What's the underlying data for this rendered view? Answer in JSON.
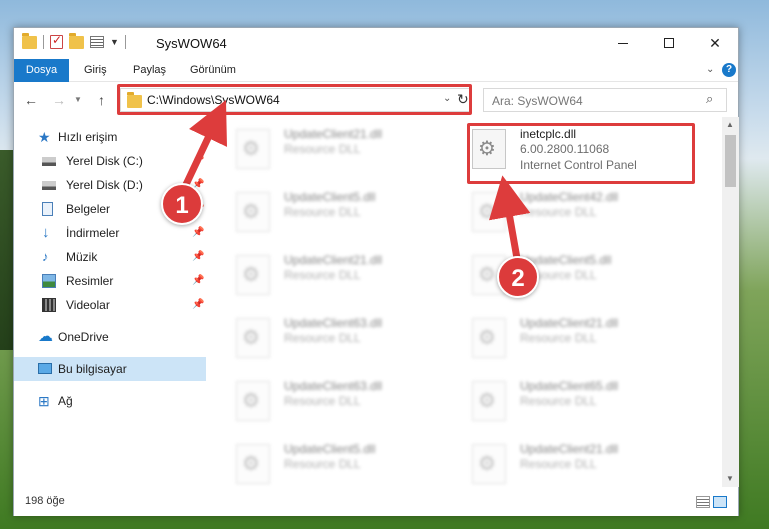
{
  "window": {
    "title": "SysWOW64",
    "min_glyph": "",
    "close_glyph": "✕"
  },
  "ribbon": {
    "tabs": [
      "Dosya",
      "Giriş",
      "Paylaş",
      "Görünüm"
    ],
    "help": "?"
  },
  "address": {
    "path": "C:\\Windows\\SysWOW64",
    "search_placeholder": "Ara: SysWOW64"
  },
  "nav": {
    "back": "←",
    "forward": "→",
    "up": "↑",
    "items": [
      {
        "label": "Hızlı erişim",
        "icon": "star-icon"
      },
      {
        "label": "Yerel Disk (C:)",
        "icon": "drive-icon"
      },
      {
        "label": "Yerel Disk (D:)",
        "icon": "drive-icon"
      },
      {
        "label": "Belgeler",
        "icon": "documents-icon"
      },
      {
        "label": "İndirmeler",
        "icon": "download-icon"
      },
      {
        "label": "Müzik",
        "icon": "music-icon"
      },
      {
        "label": "Resimler",
        "icon": "pictures-icon"
      },
      {
        "label": "Videolar",
        "icon": "videos-icon"
      },
      {
        "label": "OneDrive",
        "icon": "cloud-icon"
      },
      {
        "label": "Bu bilgisayar",
        "icon": "computer-icon"
      },
      {
        "label": "Ağ",
        "icon": "network-icon"
      }
    ]
  },
  "files": [
    {
      "name": "UpdateClient21.dll",
      "type": "Resource DLL"
    },
    {
      "name": "inetcplc.dll",
      "version": "6.00.2800.11068",
      "type": "Internet Control Panel"
    },
    {
      "name": "UpdateClient5.dll",
      "type": "Resource DLL"
    },
    {
      "name": "UpdateClient42.dll",
      "type": "Resource DLL"
    },
    {
      "name": "UpdateClient21.dll",
      "type": "Resource DLL"
    },
    {
      "name": "UpdateClient5.dll",
      "type": "Resource DLL"
    },
    {
      "name": "UpdateClient63.dll",
      "type": "Resource DLL"
    },
    {
      "name": "UpdateClient21.dll",
      "type": "Resource DLL"
    },
    {
      "name": "UpdateClient63.dll",
      "type": "Resource DLL"
    },
    {
      "name": "UpdateClient65.dll",
      "type": "Resource DLL"
    },
    {
      "name": "UpdateClient5.dll",
      "type": "Resource DLL"
    },
    {
      "name": "UpdateClient21.dll",
      "type": "Resource DLL"
    }
  ],
  "status": {
    "count": "198 öğe"
  },
  "annotations": {
    "step1": "1",
    "step2": "2",
    "color": "#dd3c3c"
  }
}
